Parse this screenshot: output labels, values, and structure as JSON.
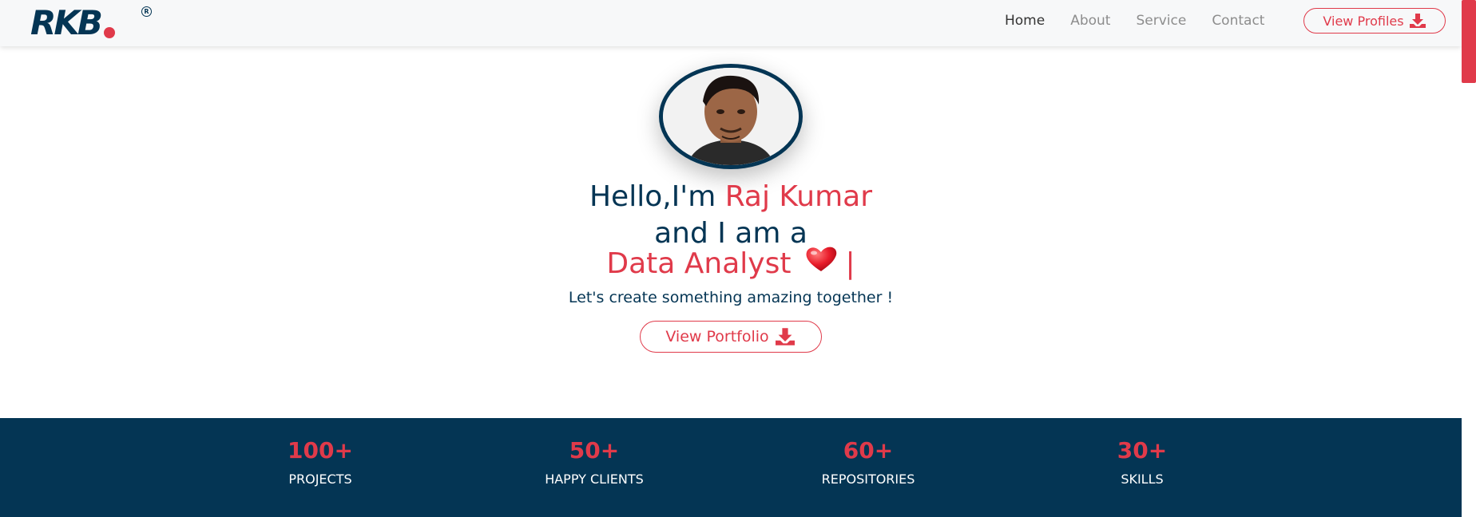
{
  "brand": {
    "logo_text": "RKB",
    "registered_mark": "R"
  },
  "nav": {
    "links": [
      {
        "label": "Home",
        "active": true
      },
      {
        "label": "About",
        "active": false
      },
      {
        "label": "Service",
        "active": false
      },
      {
        "label": "Contact",
        "active": false
      }
    ],
    "profile_button": "View Profiles"
  },
  "hero": {
    "greeting": "Hello,I'm ",
    "name": "Raj Kumar",
    "line2": "and I am a",
    "role": "Data Analyst",
    "cursor": "|",
    "tagline": "Let's create something amazing together !",
    "portfolio_button": "View Portfolio"
  },
  "stats": [
    {
      "value": "100+",
      "label": "PROJECTS"
    },
    {
      "value": "50+",
      "label": "HAPPY CLIENTS"
    },
    {
      "value": "60+",
      "label": "REPOSITORIES"
    },
    {
      "value": "30+",
      "label": "SKILLS"
    }
  ],
  "colors": {
    "primary": "#043554",
    "accent": "#e03a4a",
    "nav_bg": "#f7f8f9"
  },
  "icons": {
    "download": "download-icon",
    "heart": "heart-icon"
  }
}
